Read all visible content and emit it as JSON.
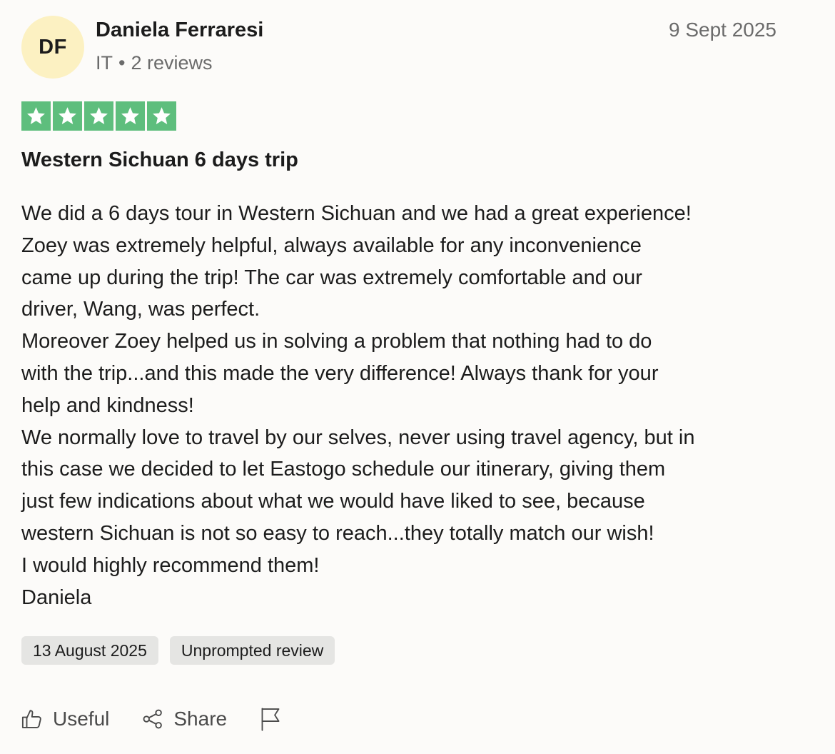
{
  "review": {
    "author": {
      "initials": "DF",
      "name": "Daniela Ferraresi",
      "country": "IT",
      "separator": "•",
      "reviews_count": "2 reviews",
      "avatar_color": "#fcf1c2"
    },
    "date": "9 Sept 2025",
    "rating": {
      "stars": 5,
      "max": 5,
      "color": "#5ebe7d"
    },
    "title": "Western Sichuan 6 days trip",
    "body_lines": [
      "We did a 6 days tour in Western Sichuan and we had a great experience!",
      "Zoey was extremely helpful, always available for any inconvenience",
      "came up during the trip! The car was extremely comfortable and our",
      "driver, Wang, was perfect.",
      "Moreover Zoey helped us in solving a problem that nothing had to do",
      "with the trip...and this made the very difference! Always thank for your",
      "help and kindness!",
      "We normally love to travel by our selves, never using travel agency, but in",
      "this case we decided to let Eastogo schedule our itinerary, giving them",
      "just few indications about what we would have liked to see, because",
      "western Sichuan is not so easy to reach...they totally match our wish!",
      "I would highly recommend them!",
      "Daniela"
    ],
    "tags": {
      "experience_date": "13 August 2025",
      "review_type": "Unprompted review"
    },
    "actions": {
      "useful_label": "Useful",
      "useful_icon": "thumbs-up-icon",
      "share_label": "Share",
      "share_icon": "share-icon",
      "report_icon": "flag-icon"
    }
  }
}
